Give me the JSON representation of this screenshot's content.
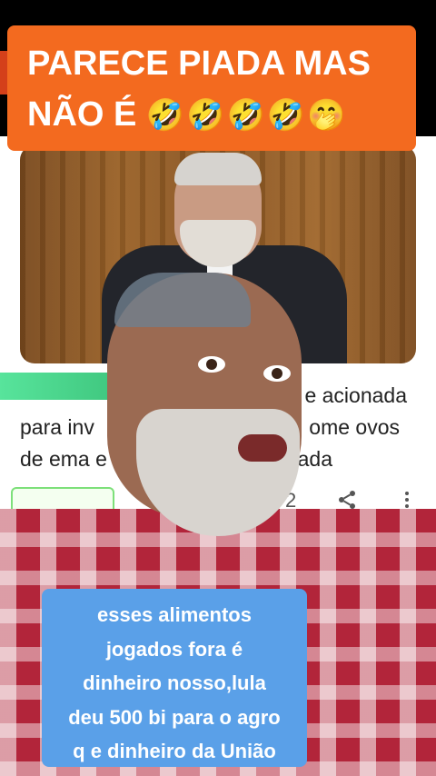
{
  "top_caption": {
    "line1": "PARECE PIADA MAS",
    "line2_text": "NÃO É",
    "line2_emojis": "🤣🤣🤣🤣🤭"
  },
  "headline": {
    "line1_right": "e acionada",
    "line2_left": "para inv",
    "line2_right": "ome ovos",
    "line3_left": "de ema e",
    "line3_right": "ada"
  },
  "actions": {
    "count_partial": "2",
    "share_icon": "share-icon",
    "more_icon": "more-vert-icon"
  },
  "bottom_caption": {
    "lines": [
      "esses alimentos",
      "jogados fora é",
      "dinheiro nosso,lula",
      "deu 500 bi para o agro",
      "q e dinheiro da União"
    ]
  },
  "colors": {
    "top_caption_bg": "#f36a1f",
    "bottom_caption_bg": "#5aa0e8"
  }
}
